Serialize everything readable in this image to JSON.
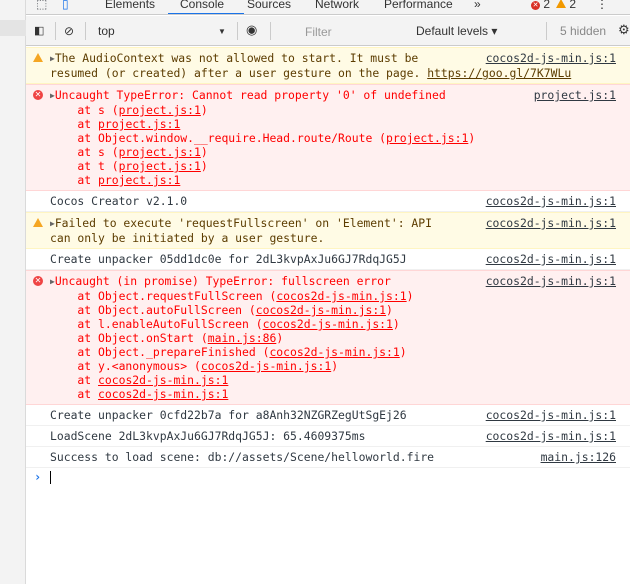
{
  "tabs": [
    "Elements",
    "Console",
    "Sources",
    "Network",
    "Performance"
  ],
  "more_tabs": "»",
  "counts": {
    "errors": "2",
    "warnings": "2"
  },
  "kebab": "⋮",
  "toolbar": {
    "context": "top",
    "context_arrow": "▼",
    "filter_placeholder": "Filter",
    "levels": "Default levels ▾",
    "hidden": "5 hidden"
  },
  "colors": {
    "accent": "#1a73e8",
    "error": "#ff0000",
    "warning_bg": "#fffbe5",
    "error_bg": "#fff0f0"
  },
  "messages": [
    {
      "level": "warn",
      "lines": [
        "The AudioContext was not allowed to start. It must be",
        "resumed (or created) after a user gesture on the page. "
      ],
      "link": "https://goo.gl/7K7WLu",
      "source": "cocos2d-js-min.js:1"
    },
    {
      "level": "error",
      "lines": [
        "Uncaught TypeError: Cannot read property '0' of undefined"
      ],
      "source": "project.js:1",
      "stack": [
        {
          "pre": "    at s (",
          "link": "project.js:1",
          "post": ")"
        },
        {
          "pre": "    at ",
          "link": "project.js:1",
          "post": ""
        },
        {
          "pre": "    at Object.window.__require.Head.route/Route (",
          "link": "project.js:1",
          "post": ")"
        },
        {
          "pre": "    at s (",
          "link": "project.js:1",
          "post": ")"
        },
        {
          "pre": "    at t (",
          "link": "project.js:1",
          "post": ")"
        },
        {
          "pre": "    at ",
          "link": "project.js:1",
          "post": ""
        }
      ]
    },
    {
      "level": "log",
      "lines": [
        "Cocos Creator v2.1.0"
      ],
      "source": "cocos2d-js-min.js:1"
    },
    {
      "level": "warn",
      "lines": [
        "Failed to execute 'requestFullscreen' on 'Element': API",
        "can only be initiated by a user gesture."
      ],
      "source": "cocos2d-js-min.js:1"
    },
    {
      "level": "log",
      "lines": [
        "Create unpacker 05dd1dc0e for 2dL3kvpAxJu6GJ7RdqJG5J"
      ],
      "source": "cocos2d-js-min.js:1"
    },
    {
      "level": "error",
      "lines": [
        "Uncaught (in promise) TypeError: fullscreen error"
      ],
      "source": "cocos2d-js-min.js:1",
      "stack": [
        {
          "pre": "    at Object.requestFullScreen (",
          "link": "cocos2d-js-min.js:1",
          "post": ")"
        },
        {
          "pre": "    at Object.autoFullScreen (",
          "link": "cocos2d-js-min.js:1",
          "post": ")"
        },
        {
          "pre": "    at l.enableAutoFullScreen (",
          "link": "cocos2d-js-min.js:1",
          "post": ")"
        },
        {
          "pre": "    at Object.onStart (",
          "link": "main.js:86",
          "post": ")"
        },
        {
          "pre": "    at Object._prepareFinished (",
          "link": "cocos2d-js-min.js:1",
          "post": ")"
        },
        {
          "pre": "    at y.<anonymous> (",
          "link": "cocos2d-js-min.js:1",
          "post": ")"
        },
        {
          "pre": "    at ",
          "link": "cocos2d-js-min.js:1",
          "post": ""
        },
        {
          "pre": "    at ",
          "link": "cocos2d-js-min.js:1",
          "post": ""
        }
      ]
    },
    {
      "level": "log",
      "lines": [
        "Create unpacker 0cfd22b7a for a8Anh32NZGRZegUtSgEj26"
      ],
      "source": "cocos2d-js-min.js:1"
    },
    {
      "level": "log",
      "lines": [
        "LoadScene 2dL3kvpAxJu6GJ7RdqJG5J: 65.4609375ms"
      ],
      "source": "cocos2d-js-min.js:1"
    },
    {
      "level": "log",
      "lines": [
        "Success to load scene: db://assets/Scene/helloworld.fire"
      ],
      "source": "main.js:126"
    }
  ],
  "prompt": "›"
}
